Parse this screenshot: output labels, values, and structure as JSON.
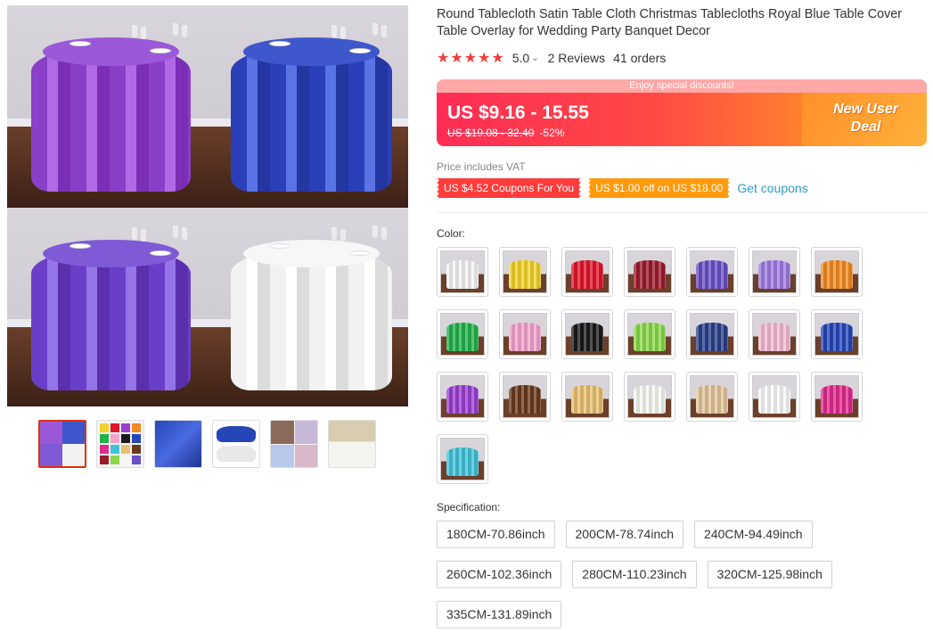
{
  "product": {
    "title": "Round Tablecloth Satin Table Cloth Christmas Tablecloths Royal Blue Table Cover Table Overlay for Wedding Party Banquet Decor",
    "rating": {
      "stars": "★★★★★",
      "value": "5.0",
      "caret": "⌄",
      "reviews": "2 Reviews",
      "orders": "41 orders"
    }
  },
  "price": {
    "banner_strip": "Enjoy special discounts!",
    "current": "US $9.16 - 15.55",
    "old": "US $19.08 - 32.40",
    "discount": "-52%",
    "new_user_line1": "New User",
    "new_user_line2": "Deal"
  },
  "vat_note": "Price includes VAT",
  "coupons": {
    "coupon1": "US $4.52 Coupons For You",
    "coupon2": "US $1.00 off on US $18.00",
    "get_coupons": "Get coupons"
  },
  "gallery": {
    "quadrants": [
      "violet",
      "royal-blue",
      "purple",
      "white"
    ],
    "thumbnails": [
      "thumb-4-colors",
      "thumb-color-grid",
      "thumb-royal-blue",
      "thumb-blue-white",
      "thumb-event-collage",
      "thumb-banquet-room"
    ],
    "active_thumbnail": 0
  },
  "color": {
    "label": "Color:",
    "options": [
      {
        "name": "white",
        "hex": "#f4f4f4"
      },
      {
        "name": "yellow",
        "hex": "#f2d22a"
      },
      {
        "name": "red",
        "hex": "#e0152a"
      },
      {
        "name": "burgundy",
        "hex": "#9c1a2c"
      },
      {
        "name": "purple",
        "hex": "#6a4fc6"
      },
      {
        "name": "lavender",
        "hex": "#9d7be0"
      },
      {
        "name": "orange",
        "hex": "#f08a22"
      },
      {
        "name": "green",
        "hex": "#22b24a"
      },
      {
        "name": "pink",
        "hex": "#f2a2cc"
      },
      {
        "name": "black",
        "hex": "#1a1a1a"
      },
      {
        "name": "light-green",
        "hex": "#8ad84a"
      },
      {
        "name": "navy",
        "hex": "#2a3f8a"
      },
      {
        "name": "light-pink",
        "hex": "#f2b8d2"
      },
      {
        "name": "royal-blue",
        "hex": "#2646b8"
      },
      {
        "name": "violet",
        "hex": "#9a3fd0"
      },
      {
        "name": "brown",
        "hex": "#6b3a1c"
      },
      {
        "name": "gold",
        "hex": "#e8c070"
      },
      {
        "name": "ivory",
        "hex": "#f6f6f2"
      },
      {
        "name": "champagne",
        "hex": "#e2c49a"
      },
      {
        "name": "white-2",
        "hex": "#f8f8f8"
      },
      {
        "name": "hot-pink",
        "hex": "#e02a8c"
      },
      {
        "name": "aqua",
        "hex": "#3fc2d8"
      }
    ]
  },
  "specification": {
    "label": "Specification:",
    "options": [
      "180CM-70.86inch",
      "200CM-78.74inch",
      "240CM-94.49inch",
      "260CM-102.36inch",
      "280CM-110.23inch",
      "320CM-125.98inch",
      "335CM-131.89inch"
    ]
  }
}
